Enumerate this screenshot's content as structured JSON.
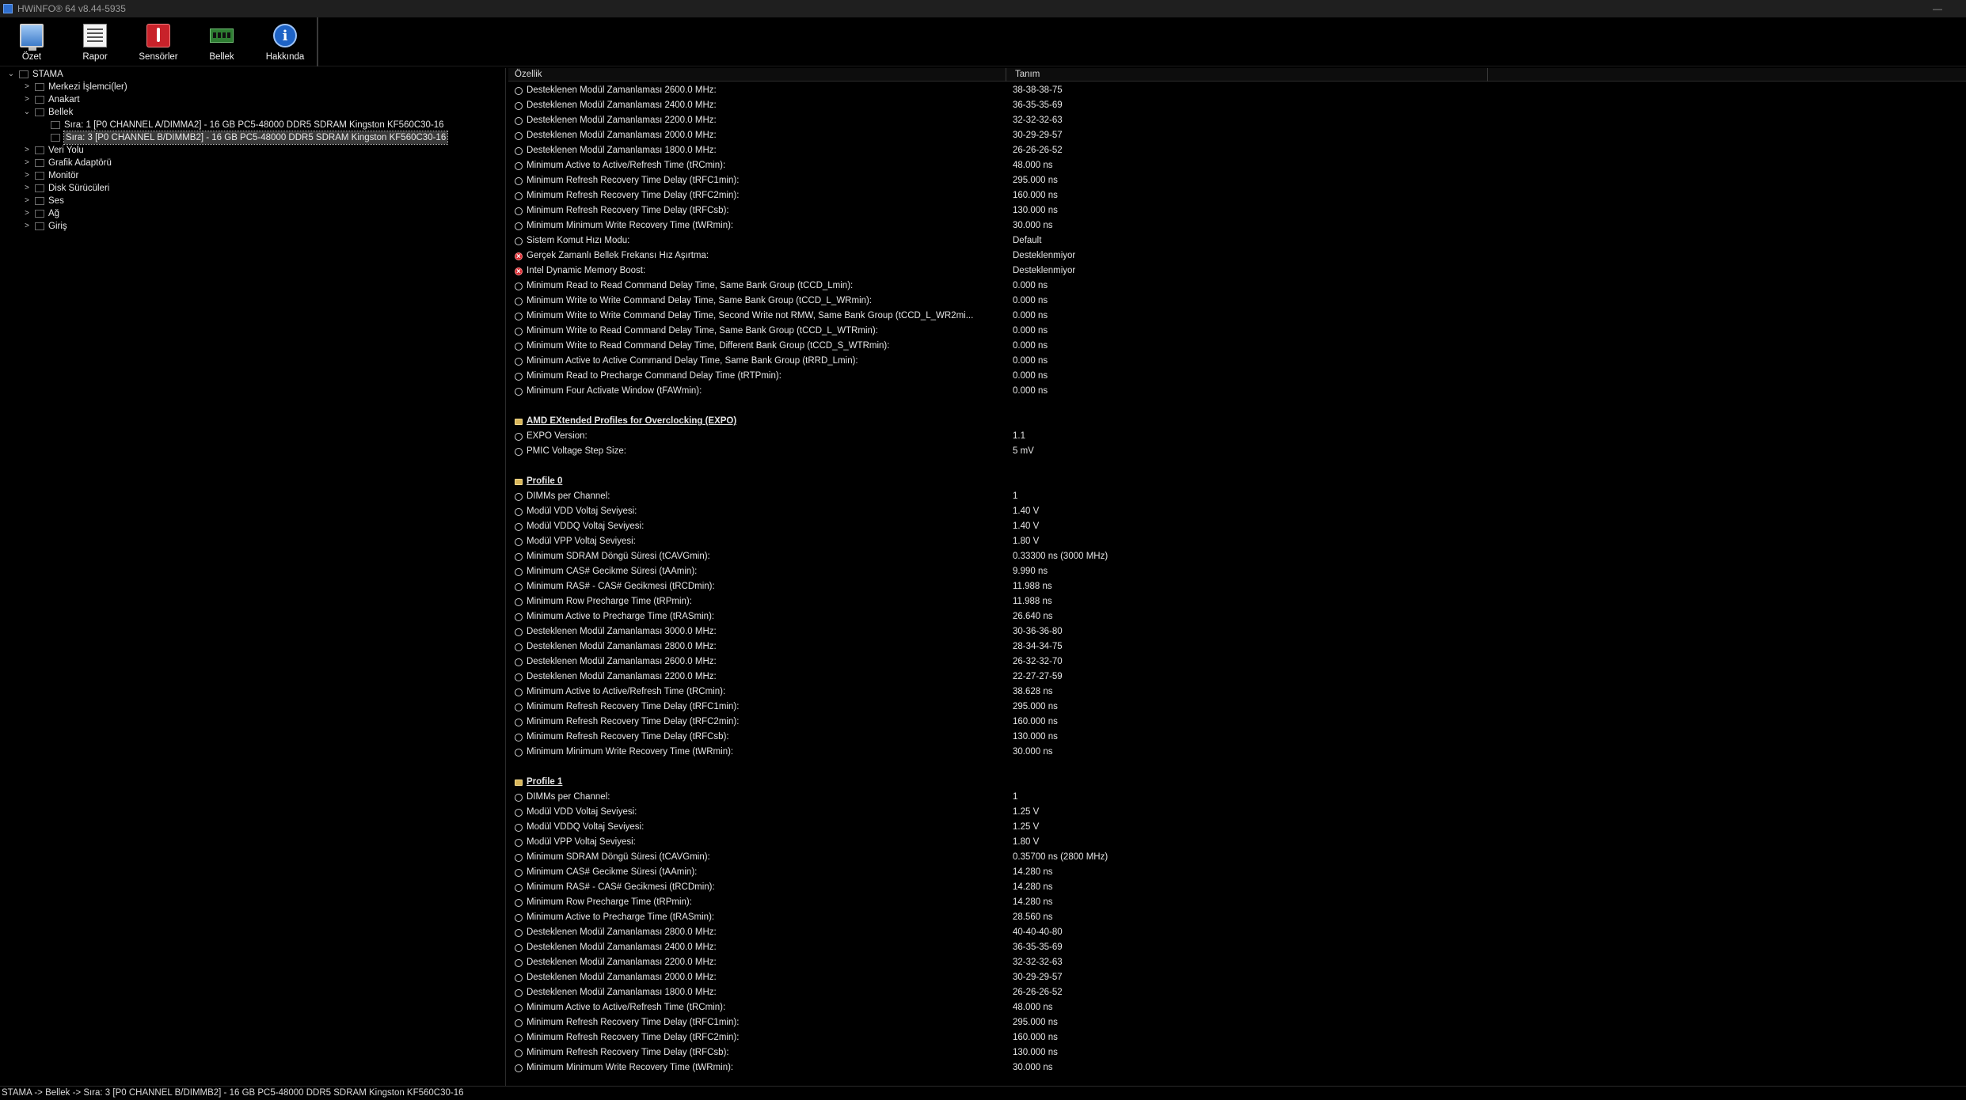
{
  "window": {
    "title": "HWiNFO® 64 v8.44-5935",
    "minimize_glyph": "—"
  },
  "toolbar": {
    "buttons": [
      {
        "label": "Özet",
        "icon": "monitor-icon"
      },
      {
        "label": "Rapor",
        "icon": "report-icon"
      },
      {
        "label": "Sensörler",
        "icon": "thermometer-icon"
      },
      {
        "label": "Bellek",
        "icon": "memory-icon"
      },
      {
        "label": "Hakkında",
        "icon": "info-icon"
      }
    ]
  },
  "tree": {
    "items": [
      {
        "label": "STAMA",
        "expander": "⌄",
        "level": 0
      },
      {
        "label": "Merkezi İşlemci(ler)",
        "expander": ">",
        "level": 1
      },
      {
        "label": "Anakart",
        "expander": ">",
        "level": 1
      },
      {
        "label": "Bellek",
        "expander": "⌄",
        "level": 1
      },
      {
        "label": "Sıra: 1 [P0 CHANNEL A/DIMMA2] - 16 GB PC5-48000 DDR5 SDRAM Kingston KF560C30-16",
        "expander": "",
        "level": 2
      },
      {
        "label": "Sıra: 3 [P0 CHANNEL B/DIMMB2] - 16 GB PC5-48000 DDR5 SDRAM Kingston KF560C30-16",
        "expander": "",
        "level": 2,
        "selected": true
      },
      {
        "label": "Veri Yolu",
        "expander": ">",
        "level": 1
      },
      {
        "label": "Grafik Adaptörü",
        "expander": ">",
        "level": 1
      },
      {
        "label": "Monitör",
        "expander": ">",
        "level": 1
      },
      {
        "label": "Disk Sürücüleri",
        "expander": ">",
        "level": 1
      },
      {
        "label": "Ses",
        "expander": ">",
        "level": 1
      },
      {
        "label": "Ağ",
        "expander": ">",
        "level": 1
      },
      {
        "label": "Giriş",
        "expander": ">",
        "level": 1
      }
    ]
  },
  "details": {
    "col_property": "Özellik",
    "col_value": "Tanım",
    "rows": [
      {
        "type": "item",
        "icon": "clock-icon",
        "prop": "Desteklenen Modül Zamanlaması 2600.0 MHz:",
        "val": "38-38-38-75"
      },
      {
        "type": "item",
        "icon": "clock-icon",
        "prop": "Desteklenen Modül Zamanlaması 2400.0 MHz:",
        "val": "36-35-35-69"
      },
      {
        "type": "item",
        "icon": "clock-icon",
        "prop": "Desteklenen Modül Zamanlaması 2200.0 MHz:",
        "val": "32-32-32-63"
      },
      {
        "type": "item",
        "icon": "clock-icon",
        "prop": "Desteklenen Modül Zamanlaması 2000.0 MHz:",
        "val": "30-29-29-57"
      },
      {
        "type": "item",
        "icon": "clock-icon",
        "prop": "Desteklenen Modül Zamanlaması 1800.0 MHz:",
        "val": "26-26-26-52"
      },
      {
        "type": "item",
        "icon": "clock-icon",
        "prop": "Minimum Active to Active/Refresh Time (tRCmin):",
        "val": "48.000 ns"
      },
      {
        "type": "item",
        "icon": "clock-icon",
        "prop": "Minimum Refresh Recovery Time Delay (tRFC1min):",
        "val": "295.000 ns"
      },
      {
        "type": "item",
        "icon": "clock-icon",
        "prop": "Minimum Refresh Recovery Time Delay (tRFC2min):",
        "val": "160.000 ns"
      },
      {
        "type": "item",
        "icon": "clock-icon",
        "prop": "Minimum Refresh Recovery Time Delay (tRFCsb):",
        "val": "130.000 ns"
      },
      {
        "type": "item",
        "icon": "clock-icon",
        "prop": "Minimum Minimum Write Recovery Time (tWRmin):",
        "val": "30.000 ns"
      },
      {
        "type": "item",
        "icon": "clock-icon",
        "prop": "Sistem Komut Hızı Modu:",
        "val": "Default"
      },
      {
        "type": "item",
        "icon": "unsupported-icon",
        "prop": "Gerçek Zamanlı Bellek Frekansı Hız Aşırtma:",
        "val": "Desteklenmiyor"
      },
      {
        "type": "item",
        "icon": "unsupported-icon",
        "prop": "Intel Dynamic Memory Boost:",
        "val": "Desteklenmiyor"
      },
      {
        "type": "item",
        "icon": "clock-icon",
        "prop": "Minimum Read to Read Command Delay Time, Same Bank Group (tCCD_Lmin):",
        "val": "0.000 ns"
      },
      {
        "type": "item",
        "icon": "clock-icon",
        "prop": "Minimum Write to Write Command Delay Time, Same Bank Group (tCCD_L_WRmin):",
        "val": "0.000 ns"
      },
      {
        "type": "item",
        "icon": "clock-icon",
        "prop": "Minimum Write to Write Command Delay Time, Second Write not RMW, Same Bank Group (tCCD_L_WR2mi...",
        "val": "0.000 ns"
      },
      {
        "type": "item",
        "icon": "clock-icon",
        "prop": "Minimum Write to Read Command Delay Time, Same Bank Group (tCCD_L_WTRmin):",
        "val": "0.000 ns"
      },
      {
        "type": "item",
        "icon": "clock-icon",
        "prop": "Minimum Write to Read Command Delay Time, Different Bank Group (tCCD_S_WTRmin):",
        "val": "0.000 ns"
      },
      {
        "type": "item",
        "icon": "clock-icon",
        "prop": "Minimum Active to Active Command Delay Time, Same Bank Group (tRRD_Lmin):",
        "val": "0.000 ns"
      },
      {
        "type": "item",
        "icon": "clock-icon",
        "prop": "Minimum Read to Precharge Command Delay Time (tRTPmin):",
        "val": "0.000 ns"
      },
      {
        "type": "item",
        "icon": "clock-icon",
        "prop": "Minimum Four Activate Window (tFAWmin):",
        "val": "0.000 ns"
      },
      {
        "type": "blank",
        "prop": "",
        "val": ""
      },
      {
        "type": "section",
        "icon": "folder-icon",
        "prop": "AMD EXtended Profiles for Overclocking (EXPO)",
        "val": ""
      },
      {
        "type": "item",
        "icon": "clock-icon",
        "prop": "EXPO Version:",
        "val": "1.1"
      },
      {
        "type": "item",
        "icon": "clock-icon",
        "prop": "PMIC Voltage Step Size:",
        "val": "5 mV"
      },
      {
        "type": "blank",
        "prop": "",
        "val": ""
      },
      {
        "type": "section",
        "icon": "folder-icon",
        "prop": "Profile 0",
        "val": ""
      },
      {
        "type": "item",
        "icon": "clock-icon",
        "prop": "DIMMs per Channel:",
        "val": "1"
      },
      {
        "type": "item",
        "icon": "clock-icon",
        "prop": "Modül VDD Voltaj Seviyesi:",
        "val": "1.40 V"
      },
      {
        "type": "item",
        "icon": "clock-icon",
        "prop": "Modül VDDQ Voltaj Seviyesi:",
        "val": "1.40 V"
      },
      {
        "type": "item",
        "icon": "clock-icon",
        "prop": "Modül VPP Voltaj Seviyesi:",
        "val": "1.80 V"
      },
      {
        "type": "item",
        "icon": "clock-icon",
        "prop": "Minimum SDRAM Döngü Süresi (tCAVGmin):",
        "val": "0.33300 ns (3000 MHz)"
      },
      {
        "type": "item",
        "icon": "clock-icon",
        "prop": "Minimum CAS# Gecikme Süresi (tAAmin):",
        "val": "9.990 ns"
      },
      {
        "type": "item",
        "icon": "clock-icon",
        "prop": "Minimum RAS# - CAS# Gecikmesi (tRCDmin):",
        "val": "11.988 ns"
      },
      {
        "type": "item",
        "icon": "clock-icon",
        "prop": "Minimum Row Precharge Time (tRPmin):",
        "val": "11.988 ns"
      },
      {
        "type": "item",
        "icon": "clock-icon",
        "prop": "Minimum Active to Precharge Time (tRASmin):",
        "val": "26.640 ns"
      },
      {
        "type": "item",
        "icon": "clock-icon",
        "prop": "Desteklenen Modül Zamanlaması 3000.0 MHz:",
        "val": "30-36-36-80"
      },
      {
        "type": "item",
        "icon": "clock-icon",
        "prop": "Desteklenen Modül Zamanlaması 2800.0 MHz:",
        "val": "28-34-34-75"
      },
      {
        "type": "item",
        "icon": "clock-icon",
        "prop": "Desteklenen Modül Zamanlaması 2600.0 MHz:",
        "val": "26-32-32-70"
      },
      {
        "type": "item",
        "icon": "clock-icon",
        "prop": "Desteklenen Modül Zamanlaması 2200.0 MHz:",
        "val": "22-27-27-59"
      },
      {
        "type": "item",
        "icon": "clock-icon",
        "prop": "Minimum Active to Active/Refresh Time (tRCmin):",
        "val": "38.628 ns"
      },
      {
        "type": "item",
        "icon": "clock-icon",
        "prop": "Minimum Refresh Recovery Time Delay (tRFC1min):",
        "val": "295.000 ns"
      },
      {
        "type": "item",
        "icon": "clock-icon",
        "prop": "Minimum Refresh Recovery Time Delay (tRFC2min):",
        "val": "160.000 ns"
      },
      {
        "type": "item",
        "icon": "clock-icon",
        "prop": "Minimum Refresh Recovery Time Delay (tRFCsb):",
        "val": "130.000 ns"
      },
      {
        "type": "item",
        "icon": "clock-icon",
        "prop": "Minimum Minimum Write Recovery Time (tWRmin):",
        "val": "30.000 ns"
      },
      {
        "type": "blank",
        "prop": "",
        "val": ""
      },
      {
        "type": "section",
        "icon": "folder-icon",
        "prop": "Profile 1",
        "val": ""
      },
      {
        "type": "item",
        "icon": "clock-icon",
        "prop": "DIMMs per Channel:",
        "val": "1"
      },
      {
        "type": "item",
        "icon": "clock-icon",
        "prop": "Modül VDD Voltaj Seviyesi:",
        "val": "1.25 V"
      },
      {
        "type": "item",
        "icon": "clock-icon",
        "prop": "Modül VDDQ Voltaj Seviyesi:",
        "val": "1.25 V"
      },
      {
        "type": "item",
        "icon": "clock-icon",
        "prop": "Modül VPP Voltaj Seviyesi:",
        "val": "1.80 V"
      },
      {
        "type": "item",
        "icon": "clock-icon",
        "prop": "Minimum SDRAM Döngü Süresi (tCAVGmin):",
        "val": "0.35700 ns (2800 MHz)"
      },
      {
        "type": "item",
        "icon": "clock-icon",
        "prop": "Minimum CAS# Gecikme Süresi (tAAmin):",
        "val": "14.280 ns"
      },
      {
        "type": "item",
        "icon": "clock-icon",
        "prop": "Minimum RAS# - CAS# Gecikmesi (tRCDmin):",
        "val": "14.280 ns"
      },
      {
        "type": "item",
        "icon": "clock-icon",
        "prop": "Minimum Row Precharge Time (tRPmin):",
        "val": "14.280 ns"
      },
      {
        "type": "item",
        "icon": "clock-icon",
        "prop": "Minimum Active to Precharge Time (tRASmin):",
        "val": "28.560 ns"
      },
      {
        "type": "item",
        "icon": "clock-icon",
        "prop": "Desteklenen Modül Zamanlaması 2800.0 MHz:",
        "val": "40-40-40-80"
      },
      {
        "type": "item",
        "icon": "clock-icon",
        "prop": "Desteklenen Modül Zamanlaması 2400.0 MHz:",
        "val": "36-35-35-69"
      },
      {
        "type": "item",
        "icon": "clock-icon",
        "prop": "Desteklenen Modül Zamanlaması 2200.0 MHz:",
        "val": "32-32-32-63"
      },
      {
        "type": "item",
        "icon": "clock-icon",
        "prop": "Desteklenen Modül Zamanlaması 2000.0 MHz:",
        "val": "30-29-29-57"
      },
      {
        "type": "item",
        "icon": "clock-icon",
        "prop": "Desteklenen Modül Zamanlaması 1800.0 MHz:",
        "val": "26-26-26-52"
      },
      {
        "type": "item",
        "icon": "clock-icon",
        "prop": "Minimum Active to Active/Refresh Time (tRCmin):",
        "val": "48.000 ns"
      },
      {
        "type": "item",
        "icon": "clock-icon",
        "prop": "Minimum Refresh Recovery Time Delay (tRFC1min):",
        "val": "295.000 ns"
      },
      {
        "type": "item",
        "icon": "clock-icon",
        "prop": "Minimum Refresh Recovery Time Delay (tRFC2min):",
        "val": "160.000 ns"
      },
      {
        "type": "item",
        "icon": "clock-icon",
        "prop": "Minimum Refresh Recovery Time Delay (tRFCsb):",
        "val": "130.000 ns"
      },
      {
        "type": "item",
        "icon": "clock-icon",
        "prop": "Minimum Minimum Write Recovery Time (tWRmin):",
        "val": "30.000 ns"
      }
    ]
  },
  "statusbar": {
    "text": "STAMA -> Bellek -> Sıra: 3 [P0 CHANNEL B/DIMMB2] - 16 GB PC5-48000 DDR5 SDRAM Kingston KF560C30-16"
  }
}
